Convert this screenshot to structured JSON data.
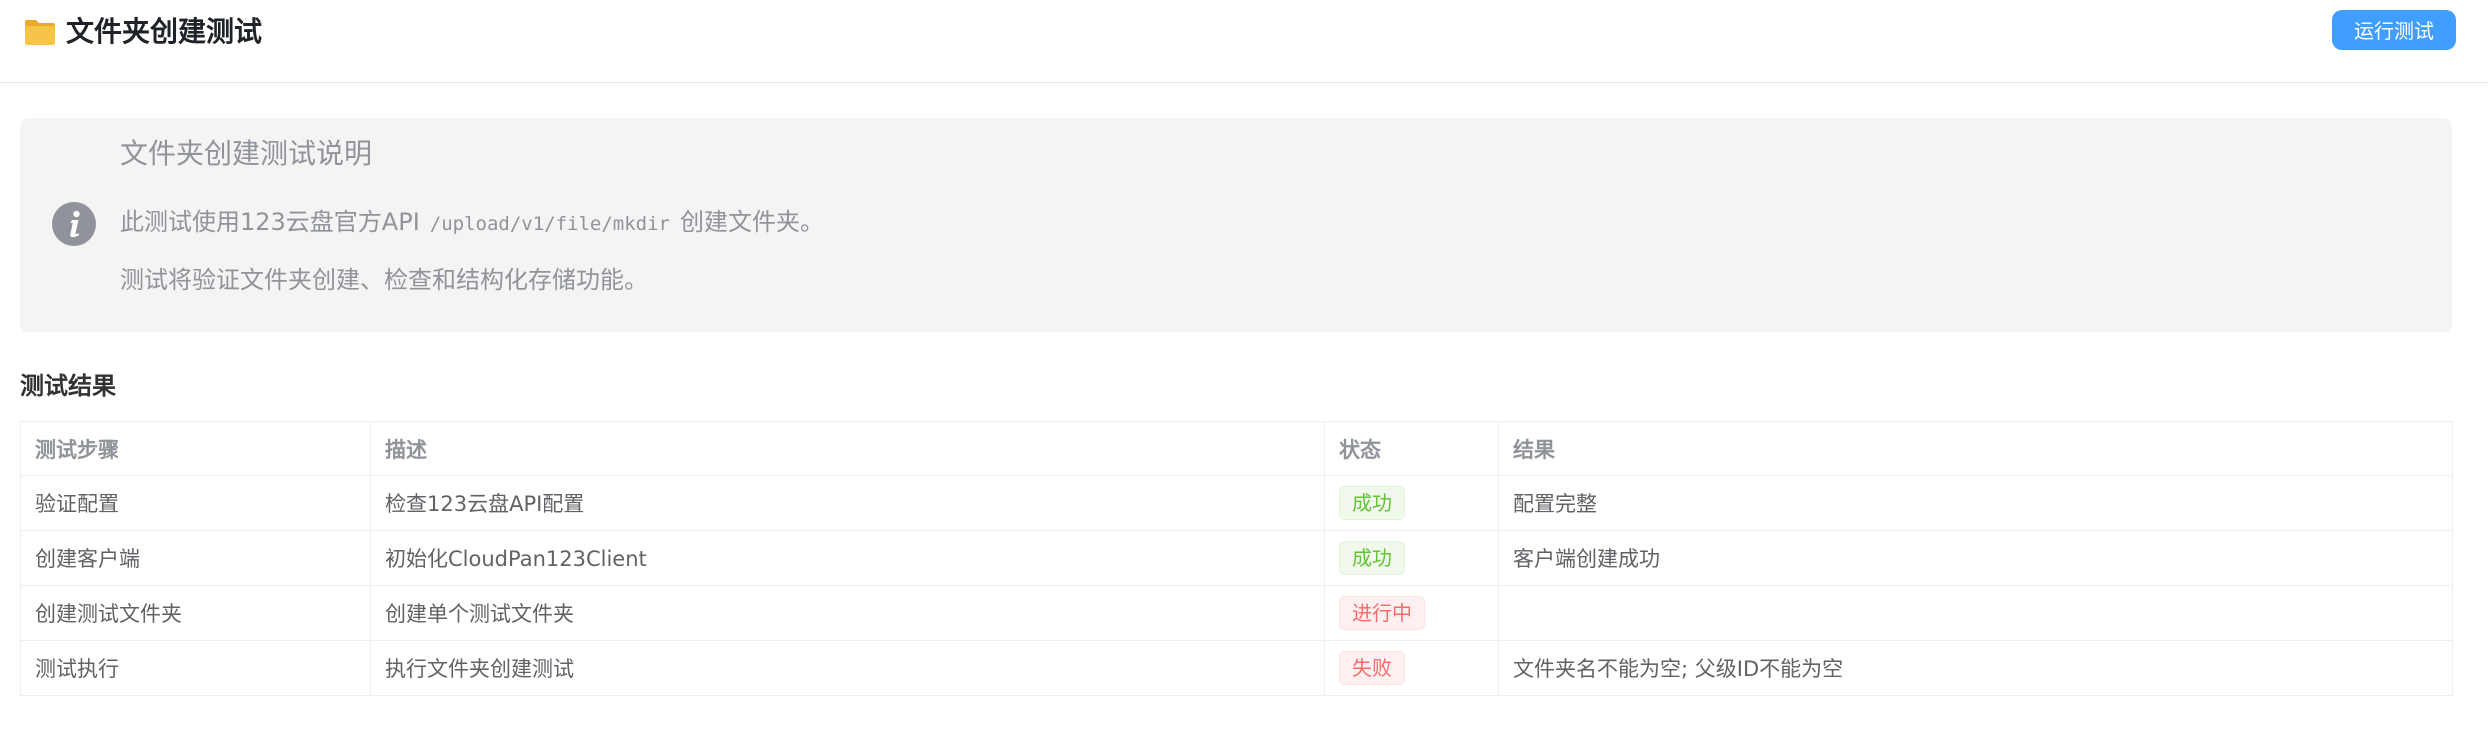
{
  "header": {
    "title": "文件夹创建测试",
    "icon": "folder-icon",
    "run_button_label": "运行测试"
  },
  "info": {
    "icon": "info-icon",
    "title": "文件夹创建测试说明",
    "line1_prefix": "此测试使用123云盘官方API",
    "line1_code": "/upload/v1/file/mkdir",
    "line1_suffix": "创建文件夹。",
    "line2": "测试将验证文件夹创建、检查和结构化存储功能。"
  },
  "results": {
    "title": "测试结果",
    "columns": [
      "测试步骤",
      "描述",
      "状态",
      "结果"
    ],
    "rows": [
      {
        "step": "验证配置",
        "desc": "检查123云盘API配置",
        "status": "成功",
        "result": "配置完整"
      },
      {
        "step": "创建客户端",
        "desc": "初始化CloudPan123Client",
        "status": "成功",
        "result": "客户端创建成功"
      },
      {
        "step": "创建测试文件夹",
        "desc": "创建单个测试文件夹",
        "status": "进行中",
        "result": ""
      },
      {
        "step": "测试执行",
        "desc": "执行文件夹创建测试",
        "status": "失败",
        "result": "文件夹名不能为空; 父级ID不能为空"
      }
    ]
  },
  "colors": {
    "primary": "#409eff",
    "success": "#67c23a",
    "danger": "#f56c6c",
    "info_bg": "#f4f4f5",
    "folder": "#f7c44a"
  }
}
